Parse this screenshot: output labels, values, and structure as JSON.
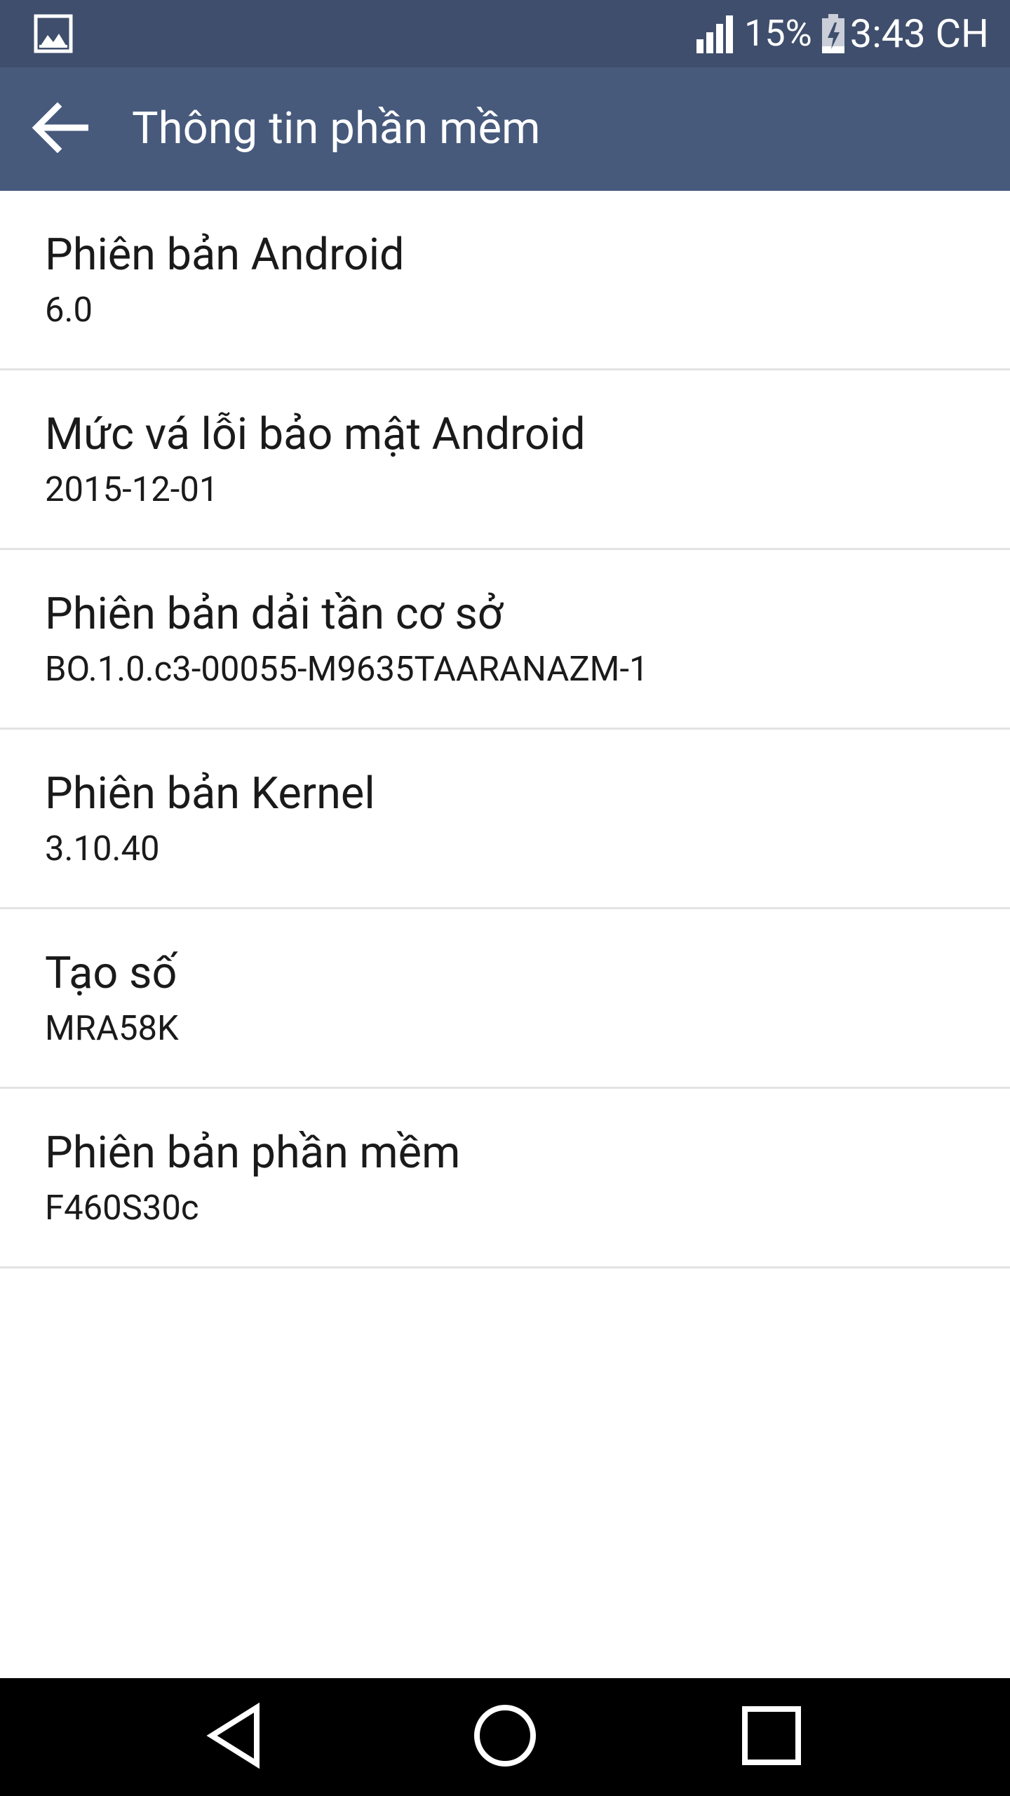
{
  "status_bar": {
    "left_icon": "image-notification-icon",
    "signal_icon": "signal-icon",
    "battery_percent": "15%",
    "battery_icon": "battery-charging-icon",
    "time": "3:43 CH"
  },
  "app_bar": {
    "back_icon": "back-arrow-icon",
    "title": "Thông tin phần mềm"
  },
  "items": [
    {
      "title": "Phiên bản Android",
      "value": "6.0"
    },
    {
      "title": "Mức vá lỗi bảo mật Android",
      "value": "2015-12-01"
    },
    {
      "title": "Phiên bản dải tần cơ sở",
      "value": "BO.1.0.c3-00055-M9635TAARANAZM-1"
    },
    {
      "title": "Phiên bản Kernel",
      "value": "3.10.40"
    },
    {
      "title": "Tạo số",
      "value": "MRA58K"
    },
    {
      "title": "Phiên bản phần mềm",
      "value": "F460S30c"
    }
  ],
  "nav_bar": {
    "back_icon": "nav-back-triangle-icon",
    "home_icon": "nav-home-circle-icon",
    "recents_icon": "nav-recents-square-icon"
  },
  "colors": {
    "status_bar": "#3f4e6c",
    "app_bar": "#475a7c",
    "divider": "#e3e3e3",
    "nav_bar": "#000000"
  }
}
